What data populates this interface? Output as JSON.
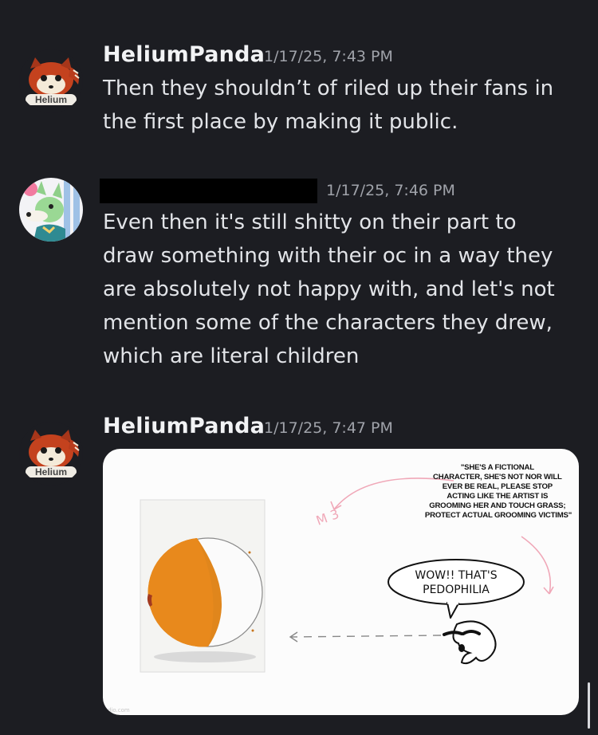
{
  "messages": [
    {
      "author": "HeliumPanda",
      "timestamp": "1/17/25, 7:43 PM",
      "avatar_badge": "Helium",
      "text_lines": [
        "Then they shouldn’t of riled up their fans in",
        "the first place by making it public."
      ]
    },
    {
      "author": "",
      "timestamp": "1/17/25, 7:46 PM",
      "text_lines": [
        "Even then it's still shitty on their part to",
        "draw something with their oc in a way they",
        "are absolutely not happy with, and let's not",
        "mention some of the characters they drew,",
        "which are literal children"
      ]
    },
    {
      "author": "HeliumPanda",
      "timestamp": "1/17/25, 7:47 PM",
      "avatar_badge": "Helium",
      "image": {
        "caption_lines": [
          "\"SHE'S A FICTIONAL",
          "CHARACTER, SHE'S NOT NOR WILL",
          "EVER BE REAL, PLEASE STOP",
          "ACTING LIKE THE ARTIST IS",
          "GROOMING HER AND TOUCH GRASS;",
          "PROTECT ACTUAL GROOMING VICTIMS\""
        ],
        "speech_line1": "WOW!! THAT'S",
        "speech_line2": "PEDOPHILIA",
        "doodle": "M 3",
        "watermark": "dio.com"
      }
    }
  ],
  "colors": {
    "background": "#1c1d22",
    "username": "#f2f3f5",
    "timestamp": "#a0a3aa",
    "body_text": "#e2e4e8"
  }
}
